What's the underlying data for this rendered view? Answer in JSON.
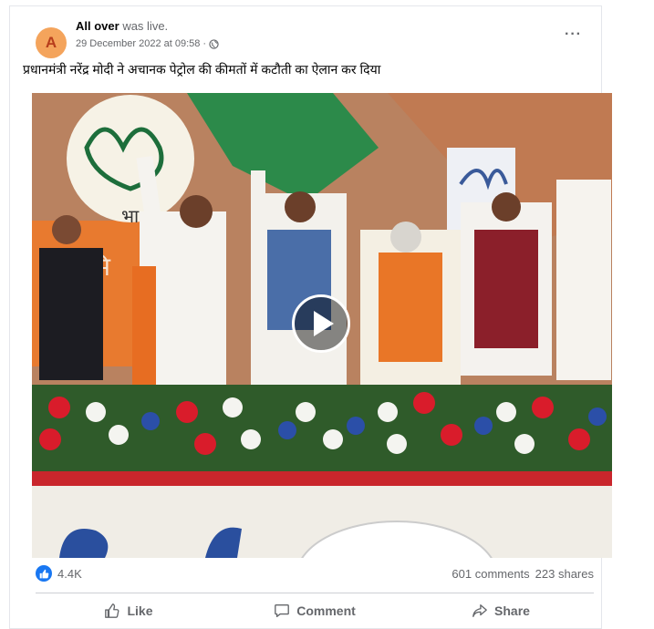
{
  "post": {
    "avatar_letter": "A",
    "author": "All over",
    "action": "was live.",
    "timestamp": "29 December 2022 at 09:58 ·",
    "privacy_icon": "globe-icon",
    "more_icon": "more-options-icon",
    "caption": "प्रधानमंत्री नरेंद्र मोदी ने अचानक पेट्रोल की कीमतों में कटौती का ऐलान कर दिया"
  },
  "video": {
    "thumbnail": "rally-stage-thumbnail",
    "play_icon": "play-icon"
  },
  "stats": {
    "reaction_icon": "like-reaction-icon",
    "reactions": "4.4K",
    "comments": "601 comments",
    "shares": "223 shares"
  },
  "actions": {
    "like": "Like",
    "comment": "Comment",
    "share": "Share"
  },
  "colors": {
    "accent": "#1877f2",
    "avatar_bg": "#f4a45c",
    "secondary_text": "#65676b"
  }
}
